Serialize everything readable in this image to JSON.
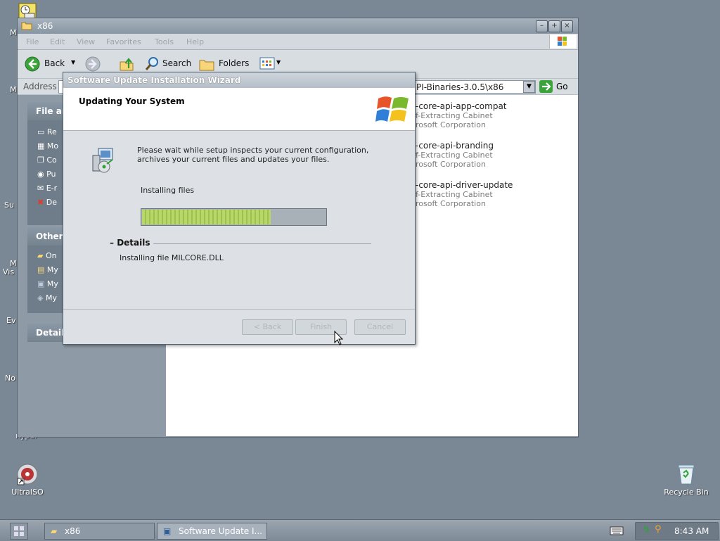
{
  "desktop": {
    "left_labels": [
      "M",
      "M",
      "Su",
      "M",
      "Vis",
      "Ev",
      "No"
    ],
    "ultraiso_label": "UltraISO",
    "recycle_label": "Recycle Bin",
    "partial_label": "nypar"
  },
  "explorer": {
    "title": "x86",
    "menu": [
      "File",
      "Edit",
      "View",
      "Favorites",
      "Tools",
      "Help"
    ],
    "toolbar": {
      "back": "Back",
      "search": "Search",
      "folders": "Folders"
    },
    "address_label": "Address",
    "address_value": "PI-Binaries-3.0.5\\x86",
    "go_label": "Go",
    "panels": {
      "file_tasks_title": "File an",
      "file_tasks": [
        "Re",
        "Mo",
        "Co",
        "Pu",
        "E-r",
        "De"
      ],
      "other_title": "Other I",
      "other_places": [
        "On",
        "My",
        "My",
        "My"
      ],
      "details_title": "Details"
    },
    "files": [
      {
        "name": "-core-api-app-compat",
        "type": "f-Extracting Cabinet",
        "company": "rosoft Corporation"
      },
      {
        "name": "-core-api-branding",
        "type": "f-Extracting Cabinet",
        "company": "rosoft Corporation"
      },
      {
        "name": "-core-api-driver-update",
        "type": "f-Extracting Cabinet",
        "company": "rosoft Corporation"
      }
    ]
  },
  "wizard": {
    "title": "Software Update Installation Wizard",
    "header": "Updating Your System",
    "description": "Please wait while setup inspects your current configuration, archives your current files and updates your files.",
    "status": "Installing files",
    "progress_fraction": 0.7,
    "details_label": "Details",
    "details_text": "Installing file MILCORE.DLL",
    "buttons": {
      "back": "< Back",
      "finish": "Finish",
      "cancel": "Cancel"
    }
  },
  "taskbar": {
    "items": [
      {
        "label": "x86"
      },
      {
        "label": "Software Update I..."
      }
    ],
    "clock": "8:43 AM"
  },
  "colors": {
    "desktop": "#7a8795",
    "progress_green": "#b8d66a",
    "xp_red": "#e8542a",
    "xp_green": "#7ab82e",
    "xp_blue": "#2f7fd8",
    "xp_yellow": "#f4c21c"
  }
}
